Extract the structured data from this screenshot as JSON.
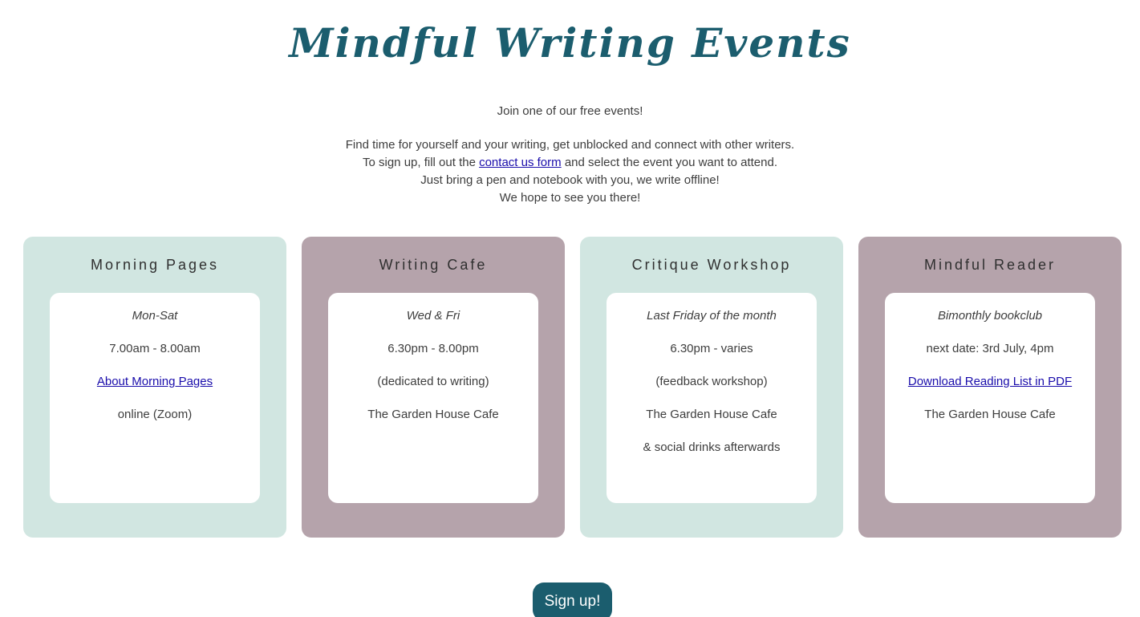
{
  "header": {
    "title": "Mindful Writing Events"
  },
  "intro": {
    "lead": "Join one of our free events!",
    "line1": "Find time for yourself and your writing, get unblocked and connect with other writers.",
    "line2_before": "To sign up, fill out the",
    "line2_link": "contact us form",
    "line2_after": "and select the event you want to attend.",
    "line3": "Just bring a pen and notebook with you, we write offline!",
    "line4": "We hope to see you there!"
  },
  "colors": {
    "accent": "#1b5d6e",
    "card_teal": "#d1e6e1",
    "card_mauve": "#b5a3ab",
    "link": "#1a0dab"
  },
  "events": [
    {
      "title": "Morning Pages",
      "schedule": "Mon-Sat",
      "time": "7.00am - 8.00am",
      "link": "About Morning Pages",
      "location": "online (Zoom)"
    },
    {
      "title": "Writing Cafe",
      "schedule": "Wed & Fri",
      "time": "6.30pm - 8.00pm",
      "note": "(dedicated to writing)",
      "location": "The Garden House Cafe"
    },
    {
      "title": "Critique Workshop",
      "schedule": "Last Friday of the month",
      "time": "6.30pm - varies",
      "note": "(feedback workshop)",
      "location": "The Garden House Cafe",
      "extra": "& social drinks afterwards"
    },
    {
      "title": "Mindful Reader",
      "schedule": "Bimonthly bookclub",
      "time": "next date: 3rd July, 4pm",
      "link": "Download Reading List in PDF",
      "location": "The Garden House Cafe"
    }
  ],
  "cta": {
    "signup_label": "Sign up!"
  }
}
